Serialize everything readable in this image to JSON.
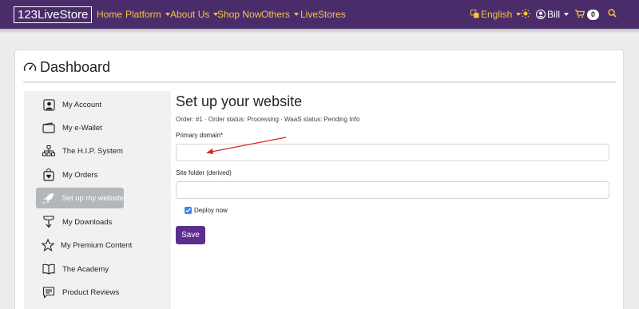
{
  "navbar": {
    "brand": "123LiveStore",
    "links": {
      "home": "Home",
      "platform": "Platform",
      "about": "About Us",
      "shop": "Shop Now",
      "others": "Others",
      "livestores": "LiveStores"
    },
    "language": "English",
    "user": "Bill",
    "cart_count": "0"
  },
  "dashboard": {
    "title": "Dashboard"
  },
  "sidebar": {
    "items": [
      {
        "label": "My Account",
        "icon": "person-square-icon"
      },
      {
        "label": "My e-Wallet",
        "icon": "wallet-icon"
      },
      {
        "label": "The H.I.P. System",
        "icon": "diagram-icon"
      },
      {
        "label": "My Orders",
        "icon": "bag-heart-icon"
      },
      {
        "label": "Set up my website",
        "icon": "rocket-icon"
      },
      {
        "label": "My Downloads",
        "icon": "download-icon"
      },
      {
        "label": "My Premium Content",
        "icon": "star-icon"
      },
      {
        "label": "The Academy",
        "icon": "book-icon"
      },
      {
        "label": "Product Reviews",
        "icon": "chat-text-icon"
      }
    ],
    "active_index": 4
  },
  "form": {
    "title": "Set up your website",
    "order_line": "Order: #1 · Order status: Processing · WaaS status: Pending Info",
    "primary_domain_label": "Primary domain*",
    "primary_domain_value": "",
    "site_folder_label": "Site folder (derived)",
    "site_folder_value": "",
    "deploy_label": "Deploy now",
    "deploy_checked": true,
    "save_label": "Save"
  },
  "colors": {
    "navbar_bg": "#4b2c6b",
    "nav_link": "#f6c342",
    "save_button": "#5b2d8e",
    "annotation_arrow": "#d62828"
  }
}
